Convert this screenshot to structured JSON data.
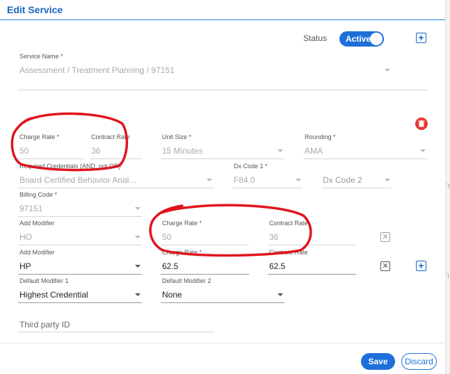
{
  "dialog": {
    "title": "Edit Service"
  },
  "status": {
    "label": "Status",
    "value": "Active"
  },
  "service_name": {
    "label": "Service Name *",
    "value": "Assessment / Treatment Planning / 97151"
  },
  "rates": {
    "charge_rate": {
      "label": "Charge Rate *",
      "value": "50"
    },
    "contract_rate": {
      "label": "Contract Rate",
      "value": "36"
    },
    "unit_size": {
      "label": "Unit Size *",
      "value": "15 Minutes"
    },
    "rounding": {
      "label": "Rounding *",
      "value": "AMA"
    }
  },
  "credentials": {
    "label": "Required Credentials (AND, not OR)",
    "value": "Board Certified Behavior Anal..."
  },
  "dx_code_1": {
    "label": "Dx Code 1 *",
    "value": "F84.0"
  },
  "dx_code_2": {
    "placeholder": "Dx Code 2"
  },
  "billing_code": {
    "label": "Billing Code *",
    "value": "97151"
  },
  "modifiers": [
    {
      "label": "Add Modifier",
      "value": "HO",
      "charge_label": "Charge Rate *",
      "charge_value": "50",
      "contract_label": "Contract Rate",
      "contract_value": "36"
    },
    {
      "label": "Add Modifier",
      "value": "HP",
      "charge_label": "Charge Rate *",
      "charge_value": "62.5",
      "contract_label": "Contract Rate",
      "contract_value": "62.5"
    }
  ],
  "default_modifier_1": {
    "label": "Default Modifier 1",
    "value": "Highest Credential"
  },
  "default_modifier_2": {
    "label": "Default Modifier 2",
    "value": "None"
  },
  "third_party": {
    "placeholder": "Third party ID"
  },
  "footer": {
    "save_label": "Save",
    "discard_label": "Discard"
  },
  "colors": {
    "accent": "#1e6fd9",
    "danger": "#e53935",
    "annotation": "#e0141e"
  },
  "icons": [
    "plus-icon",
    "trash-icon",
    "close-icon",
    "chevron-down-icon"
  ]
}
